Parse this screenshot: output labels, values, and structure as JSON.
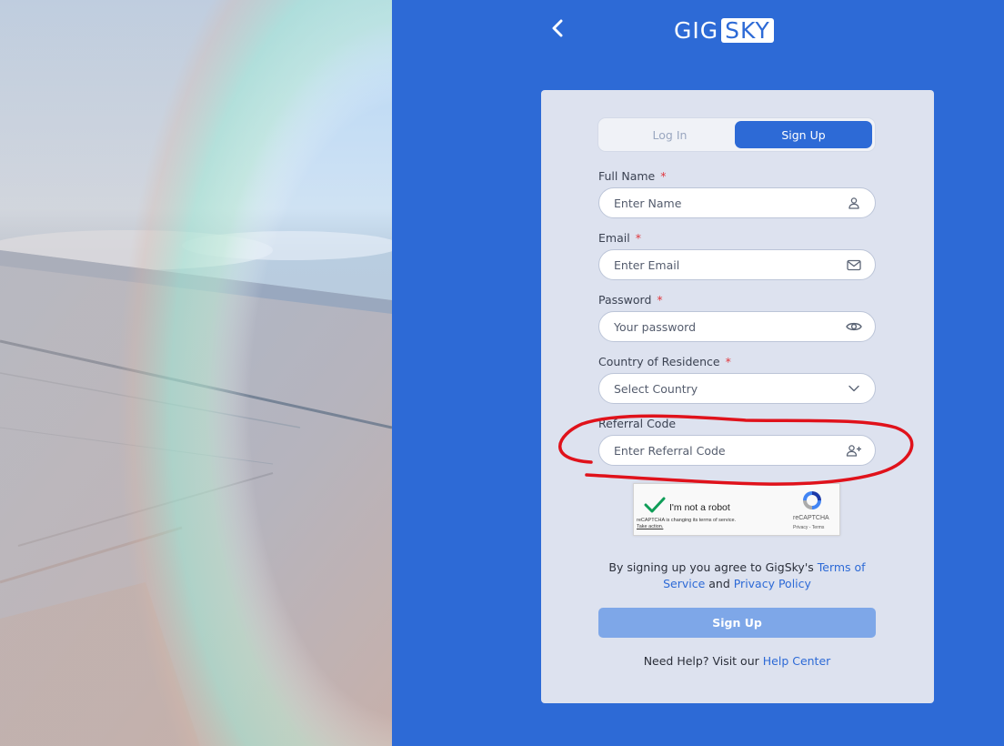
{
  "brand": {
    "part1": "GIG",
    "part2": "SKY"
  },
  "tabs": {
    "login": "Log In",
    "signup": "Sign Up"
  },
  "form": {
    "full_name": {
      "label": "Full Name",
      "required": "*",
      "placeholder": "Enter Name"
    },
    "email": {
      "label": "Email",
      "required": "*",
      "placeholder": "Enter Email"
    },
    "password": {
      "label": "Password",
      "required": "*",
      "placeholder": "Your password"
    },
    "country": {
      "label": "Country of Residence",
      "required": "*",
      "placeholder": "Select Country"
    },
    "referral": {
      "label": "Referral Code",
      "placeholder": "Enter Referral Code"
    }
  },
  "captcha": {
    "label": "I'm not a robot",
    "notice": "reCAPTCHA is changing its terms of service.",
    "action": "Take action.",
    "brand": "reCAPTCHA",
    "links": "Privacy - Terms"
  },
  "agreement": {
    "prefix": "By signing up you agree to GigSky's ",
    "terms": "Terms of Service",
    "and": " and ",
    "privacy": "Privacy Policy"
  },
  "submit_label": "Sign Up",
  "help": {
    "prefix": "Need Help? Visit our ",
    "link": "Help Center"
  },
  "icons": {
    "back": "chevron-left-icon",
    "name": "user-icon",
    "email": "mail-icon",
    "password": "eye-icon",
    "country": "chevron-down-icon",
    "referral": "user-plus-icon"
  },
  "colors": {
    "brand_blue": "#2d6ad6",
    "annotation_red": "#e0121b",
    "button_disabled": "#7ea7e8"
  }
}
